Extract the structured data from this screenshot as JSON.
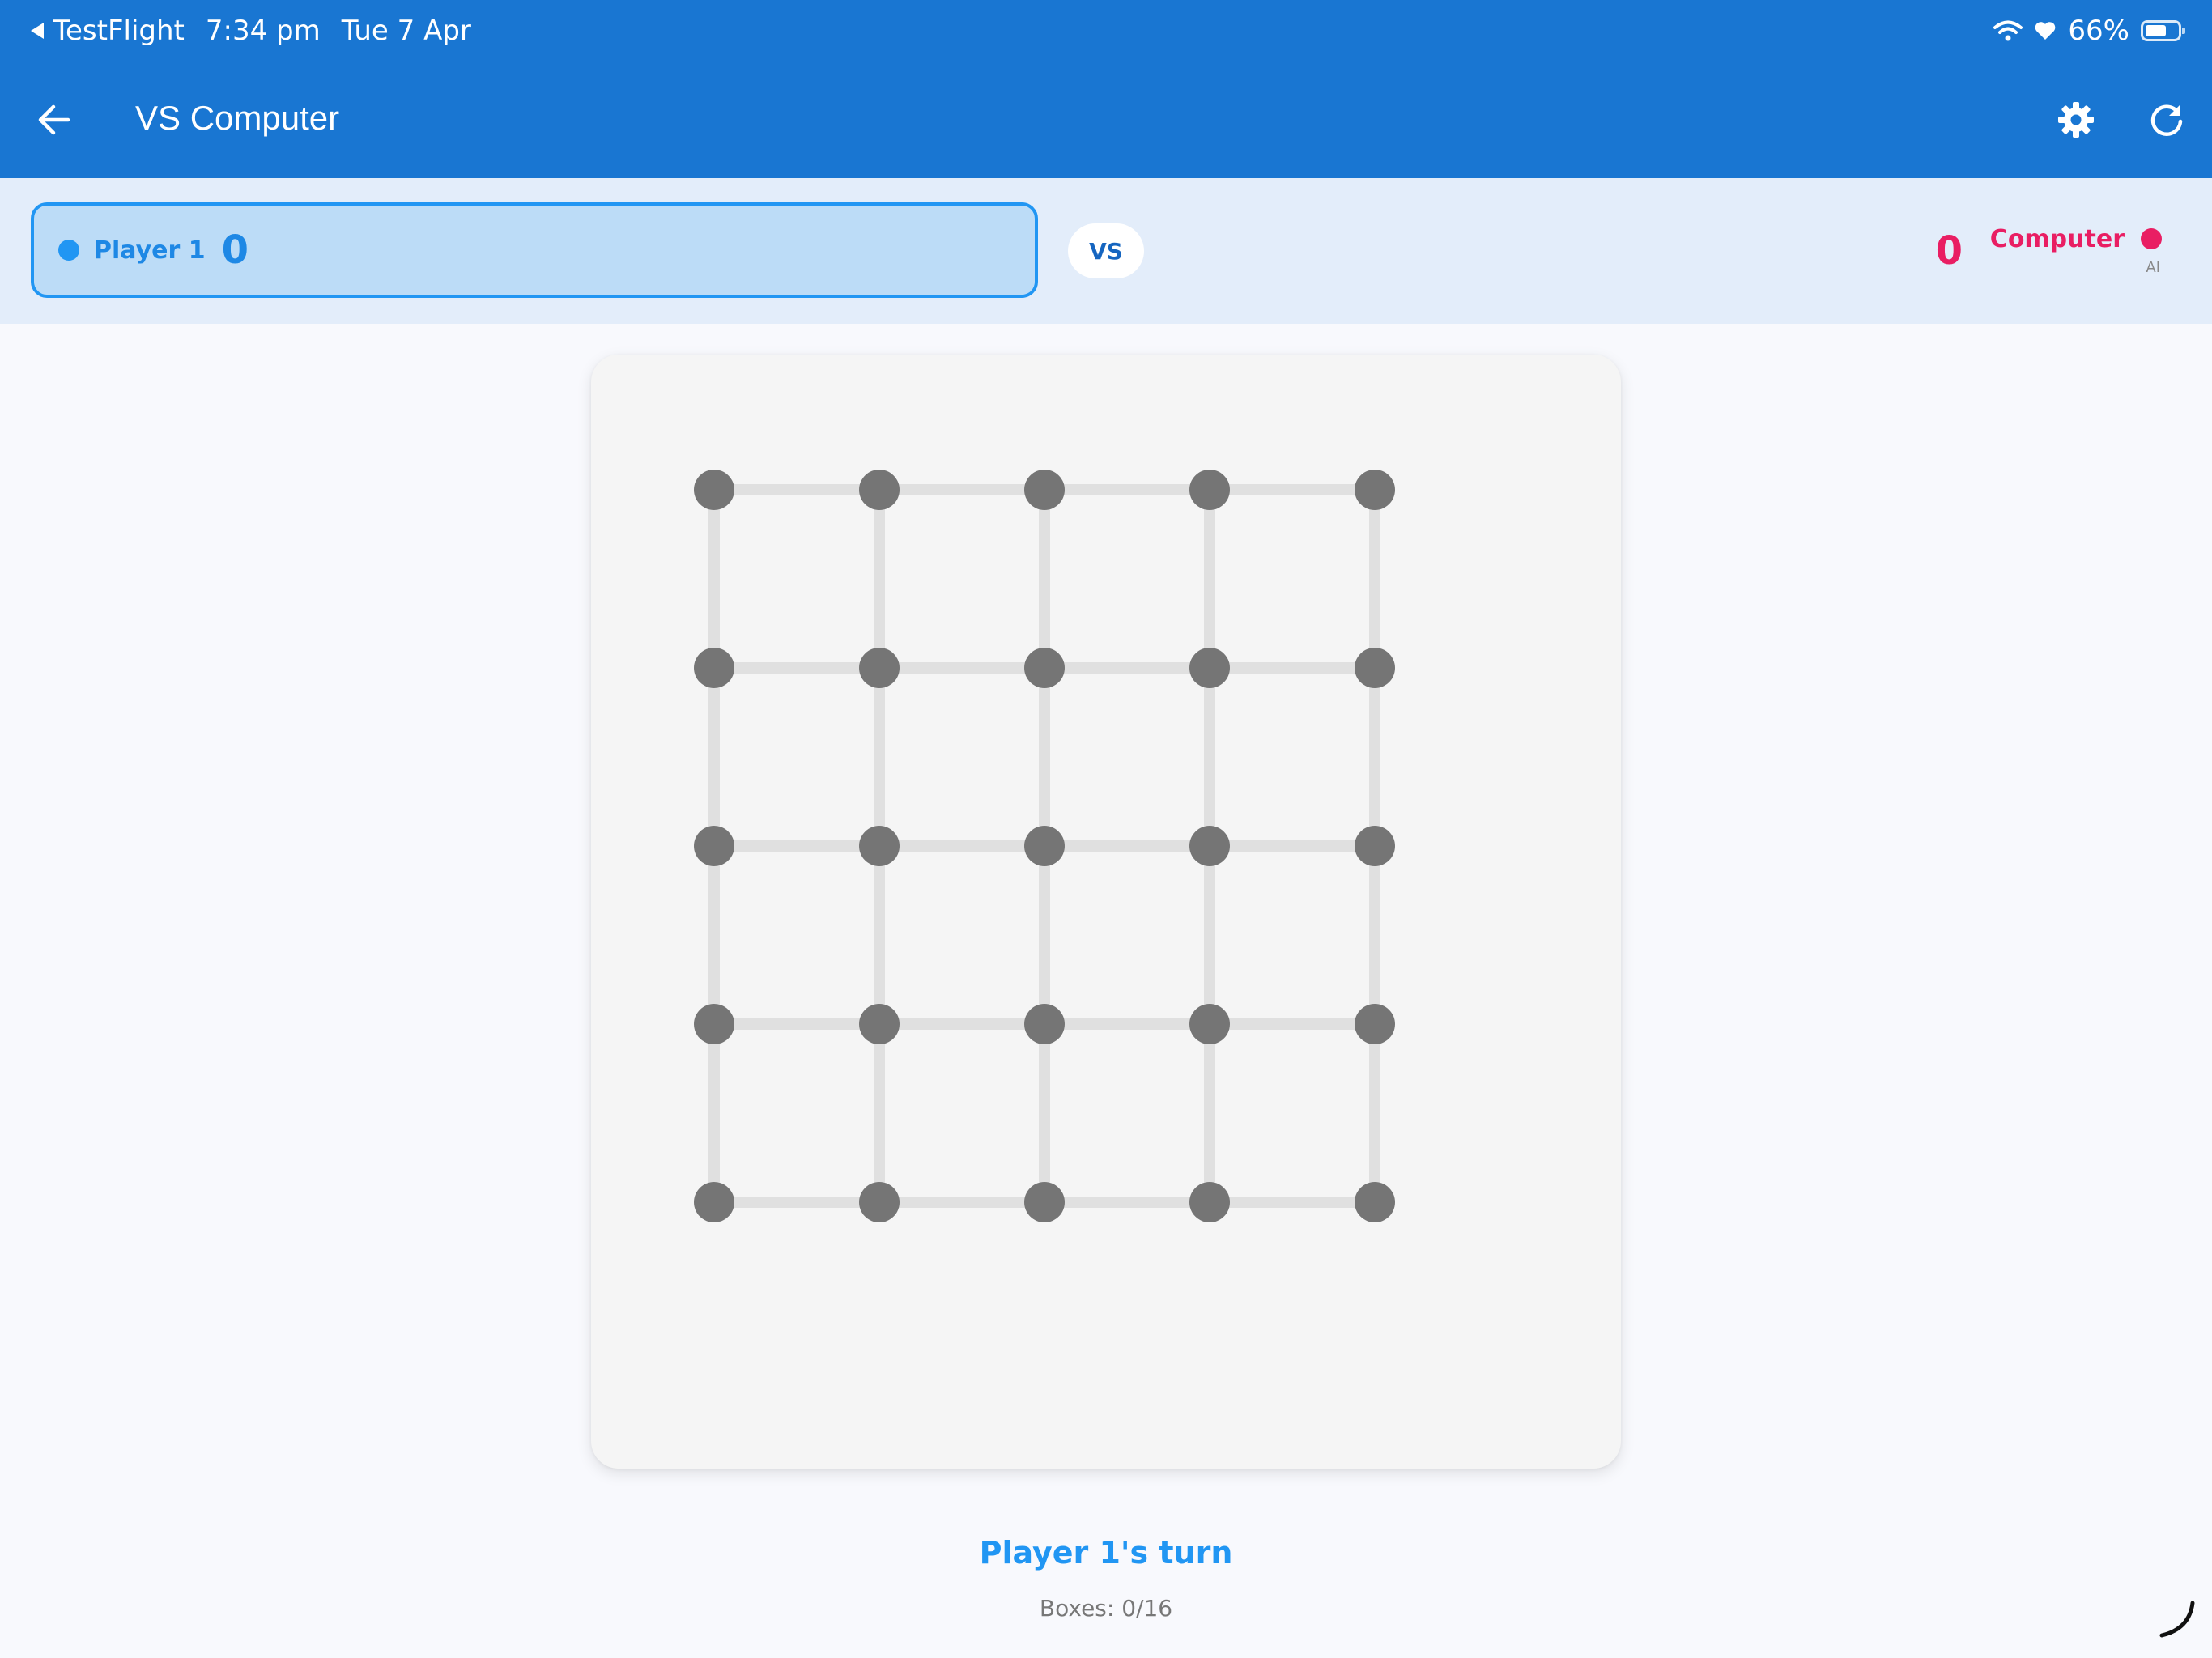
{
  "status_bar": {
    "app_back_label": "TestFlight",
    "time": "7:34 pm",
    "date": "Tue 7 Apr",
    "battery_percent": "66%",
    "battery_level": 0.66
  },
  "app_bar": {
    "title": "VS Computer",
    "back_icon": "arrow-left-icon",
    "settings_icon": "gear-icon",
    "restart_icon": "refresh-icon"
  },
  "score_bar": {
    "player1": {
      "name": "Player 1",
      "score": "0",
      "color": "#2196f3"
    },
    "vs_label": "VS",
    "computer": {
      "name": "Computer",
      "score": "0",
      "subtitle": "AI",
      "color": "#e91e63"
    }
  },
  "board": {
    "dots_per_side": 5,
    "total_boxes": 16,
    "dot_color": "#757575",
    "line_color": "#e0e0e0",
    "background": "#f5f5f5"
  },
  "footer": {
    "turn_text": "Player 1's turn",
    "boxes_text": "Boxes: 0/16"
  },
  "colors": {
    "primary": "#1976d2",
    "accent": "#2196f3",
    "computer": "#e91e63"
  }
}
